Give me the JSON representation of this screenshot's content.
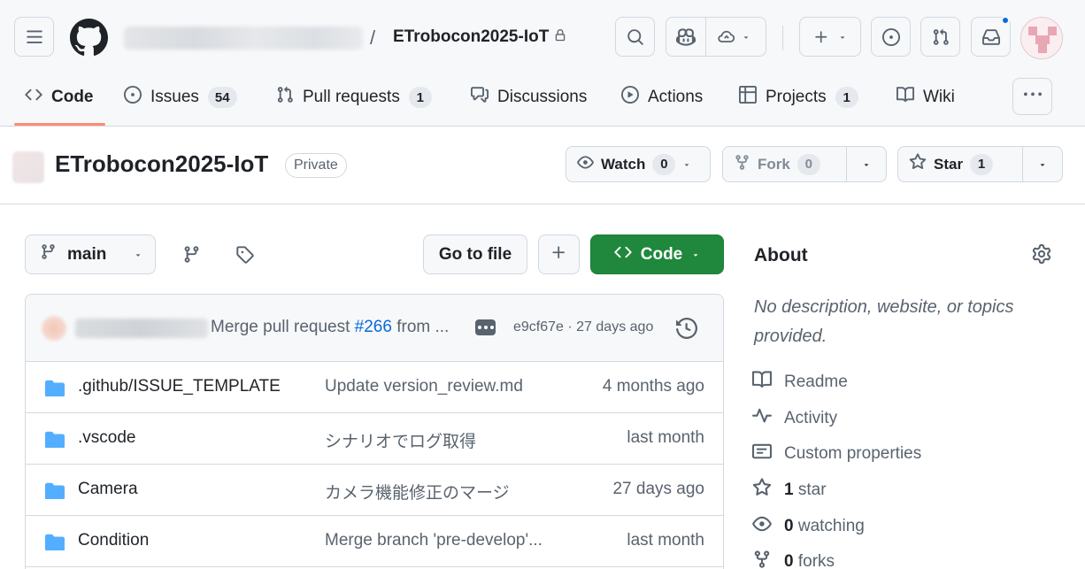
{
  "header": {
    "repo_crumb": "ETrobocon2025-IoT",
    "crumb_separator": "/",
    "icons": [
      "menu-icon",
      "github-logo-icon",
      "lock-icon",
      "search-icon",
      "copilot-icon",
      "copilot-dropdown-icon",
      "plus-icon",
      "issue-icon",
      "pull-request-icon",
      "inbox-icon"
    ]
  },
  "tabs": [
    {
      "label": "Code",
      "icon": "code-icon",
      "selected": true
    },
    {
      "label": "Issues",
      "icon": "issue-icon",
      "count": "54"
    },
    {
      "label": "Pull requests",
      "icon": "pull-request-icon",
      "count": "1"
    },
    {
      "label": "Discussions",
      "icon": "discussion-icon"
    },
    {
      "label": "Actions",
      "icon": "play-icon"
    },
    {
      "label": "Projects",
      "icon": "table-icon",
      "count": "1"
    },
    {
      "label": "Wiki",
      "icon": "book-icon"
    }
  ],
  "repo": {
    "name": "ETrobocon2025-IoT",
    "visibility": "Private",
    "watch": {
      "label": "Watch",
      "count": "0"
    },
    "fork": {
      "label": "Fork",
      "count": "0"
    },
    "star": {
      "label": "Star",
      "count": "1"
    }
  },
  "toolbar": {
    "branch": "main",
    "go_to_file": "Go to file",
    "code_button": "Code"
  },
  "latest_commit": {
    "message_prefix": "Merge pull request ",
    "pr_link": "#266",
    "message_suffix": " from ...",
    "meta": "e9cf67e · 27 days ago"
  },
  "files": [
    {
      "name": ".github/ISSUE_TEMPLATE",
      "message": "Update version_review.md",
      "date": "4 months ago"
    },
    {
      "name": ".vscode",
      "message": "シナリオでログ取得",
      "date": "last month"
    },
    {
      "name": "Camera",
      "message": "カメラ機能修正のマージ",
      "date": "27 days ago"
    },
    {
      "name": "Condition",
      "message": "Merge branch 'pre-develop'...",
      "date": "last month"
    }
  ],
  "about": {
    "title": "About",
    "description": "No description, website, or topics provided.",
    "readme": "Readme",
    "activity": "Activity",
    "custom_properties": "Custom properties",
    "stars_count": "1",
    "stars_label": " star",
    "watching_count": "0",
    "watching_label": " watching",
    "forks_count": "0",
    "forks_label": " forks"
  },
  "colors": {
    "accent": "#0969da",
    "code_button": "#1f883d",
    "tab_underline": "#fd8c73",
    "folder": "#54aeff",
    "notification_dot": "#0969da"
  }
}
